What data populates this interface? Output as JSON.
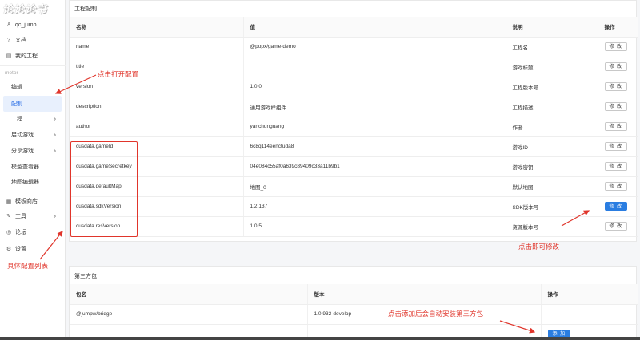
{
  "logo": "论论论书",
  "sidebar": {
    "top": [
      {
        "label": "qc_jump",
        "icon": "user-icon",
        "glyph": "♙"
      },
      {
        "label": "文档",
        "icon": "question-icon",
        "glyph": "?"
      },
      {
        "label": "我的工程",
        "icon": "project-icon",
        "glyph": "▤"
      }
    ],
    "group_label": "motor",
    "items": [
      {
        "label": "编辑"
      },
      {
        "label": "配制",
        "active": true
      },
      {
        "label": "工程",
        "chevron": true
      },
      {
        "label": "启动游戏",
        "chevron": true
      },
      {
        "label": "分享游戏",
        "chevron": true
      },
      {
        "label": "模型查看器"
      },
      {
        "label": "地图编辑器"
      }
    ],
    "bottom": [
      {
        "label": "模板商店",
        "icon": "store-icon",
        "glyph": "▦"
      },
      {
        "label": "工具",
        "icon": "wrench-icon",
        "glyph": "✎",
        "chevron": true
      },
      {
        "label": "论坛",
        "icon": "chat-icon",
        "glyph": "◎"
      },
      {
        "label": "设置",
        "icon": "gear-icon",
        "glyph": "⚙"
      }
    ]
  },
  "config": {
    "title": "工程配制",
    "headers": [
      "名称",
      "值",
      "说明",
      "操作"
    ],
    "rows": [
      {
        "name": "name",
        "value": "@popx/game-demo",
        "desc": "工程名",
        "action": "修 改"
      },
      {
        "name": "title",
        "value": "",
        "desc": "游戏标题",
        "action": "修 改"
      },
      {
        "name": "version",
        "value": "1.0.0",
        "desc": "工程版本号",
        "action": "修 改"
      },
      {
        "name": "description",
        "value": "通用游戏样组件",
        "desc": "工程描述",
        "action": "修 改"
      },
      {
        "name": "author",
        "value": "yanchunguang",
        "desc": "作者",
        "action": "修 改"
      },
      {
        "name": "cusdata.gameId",
        "value": "6c8q114eenctuda8",
        "desc": "游戏ID",
        "action": "修 改"
      },
      {
        "name": "cusdata.gameSecretkey",
        "value": "04e084c55af0a639c89409c33a11b9b1",
        "desc": "游戏密钥",
        "action": "修 改"
      },
      {
        "name": "cusdata.defaultMap",
        "value": "地图_0",
        "desc": "默认地图",
        "action": "修 改"
      },
      {
        "name": "cusdata.sdkVersion",
        "value": "1.2.137",
        "desc": "SDK版本号",
        "action": "修 改",
        "primary": true
      },
      {
        "name": "cusdata.resVersion",
        "value": "1.0.5",
        "desc": "资源版本号",
        "action": "修 改"
      }
    ]
  },
  "third_party": {
    "title": "第三方包",
    "headers": [
      "包名",
      "版本",
      "操作"
    ],
    "rows": [
      {
        "name": "@jumpw/bridge",
        "version": "1.0.932-develop",
        "action": ""
      },
      {
        "name": "-",
        "version": "-",
        "action": "添 加"
      }
    ]
  },
  "annotations": {
    "open_config": "点击打开配置",
    "config_list": "具体配置列表",
    "click_edit": "点击即可修改",
    "add_install": "点击添加后会自动安装第三方包"
  },
  "colors": {
    "accent": "#2a7de1",
    "annotation": "#e0352b",
    "active_bg": "#e8f0fd"
  }
}
